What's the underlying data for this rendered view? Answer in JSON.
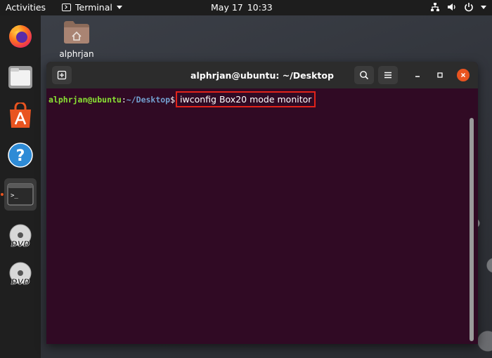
{
  "topbar": {
    "activities": "Activities",
    "app_name": "Terminal",
    "date": "May 17",
    "time": "10:33",
    "tray_icons": [
      "network-icon",
      "volume-icon",
      "power-icon"
    ]
  },
  "dock": {
    "items": [
      "firefox-icon",
      "files-icon",
      "software-icon",
      "help-icon",
      "terminal-icon",
      "dvd-icon",
      "dvd-icon"
    ],
    "dvd_label": "DVD"
  },
  "desktop": {
    "home_label": "alphrjan"
  },
  "terminal": {
    "title": "alphrjan@ubuntu: ~/Desktop",
    "prompt_user": "alphrjan@ubuntu",
    "prompt_sep": ":",
    "prompt_path": "~/Desktop",
    "prompt_symbol": "$",
    "command": "iwconfig Box20 mode monitor",
    "highlight_color": "#e2231a"
  },
  "colors": {
    "terminal_bg": "#300a24",
    "accent": "#e95420"
  }
}
